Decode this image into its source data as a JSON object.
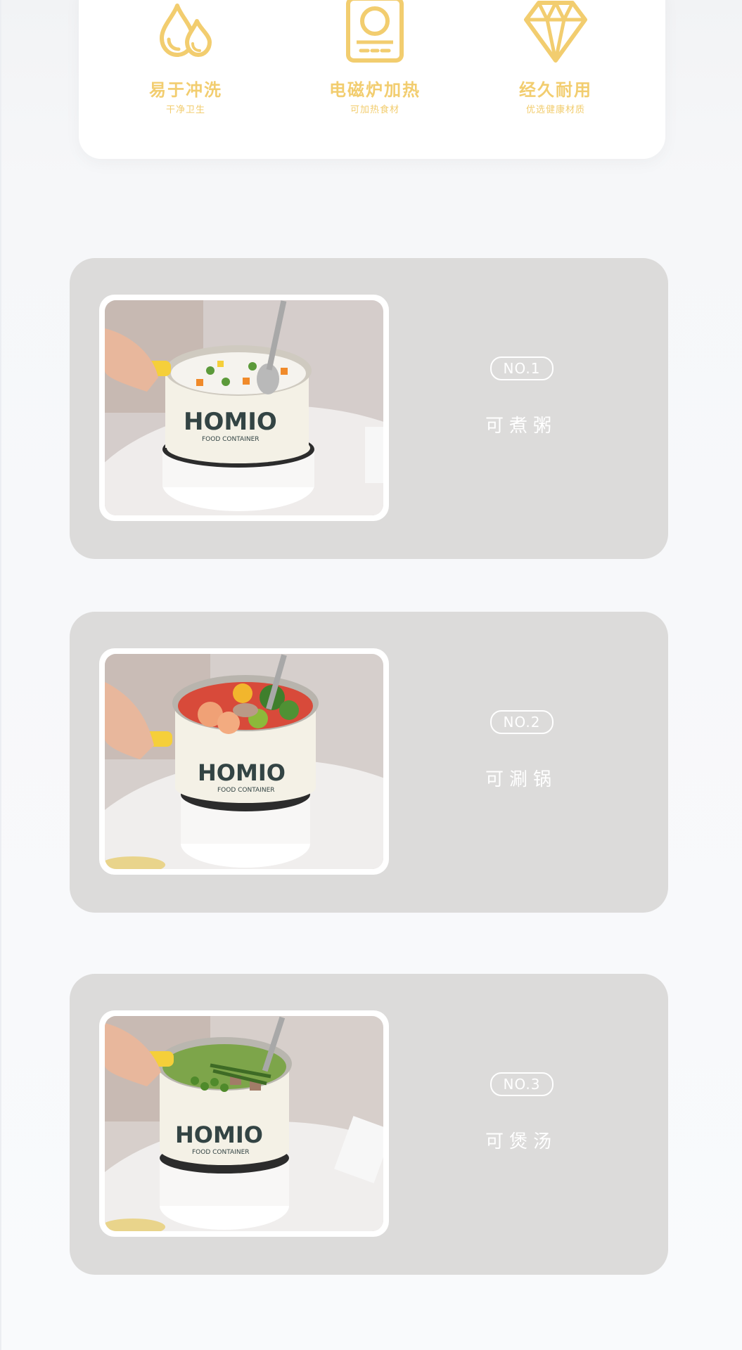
{
  "features": [
    {
      "title": "易于冲洗",
      "subtitle": "干净卫生",
      "icon": "water-drops-icon"
    },
    {
      "title": "电磁炉加热",
      "subtitle": "可加热食材",
      "icon": "induction-cooker-icon"
    },
    {
      "title": "经久耐用",
      "subtitle": "优选健康材质",
      "icon": "diamond-icon"
    }
  ],
  "sections": [
    {
      "number": "NO.1",
      "label": "可煮粥",
      "food": "porridge with peas, carrots and corn"
    },
    {
      "number": "NO.2",
      "label": "可涮锅",
      "food": "hot pot with shrimp, broccoli and kiwi"
    },
    {
      "number": "NO.3",
      "label": "可煲汤",
      "food": "green soup with peas and asparagus"
    }
  ],
  "brand": {
    "name": "HOMIO",
    "tagline": "FOOD CONTAINER"
  },
  "colors": {
    "accent_yellow": "#f2cd6f",
    "section_bg": "#dcdbda",
    "page_bg": "#f7f8fa"
  }
}
